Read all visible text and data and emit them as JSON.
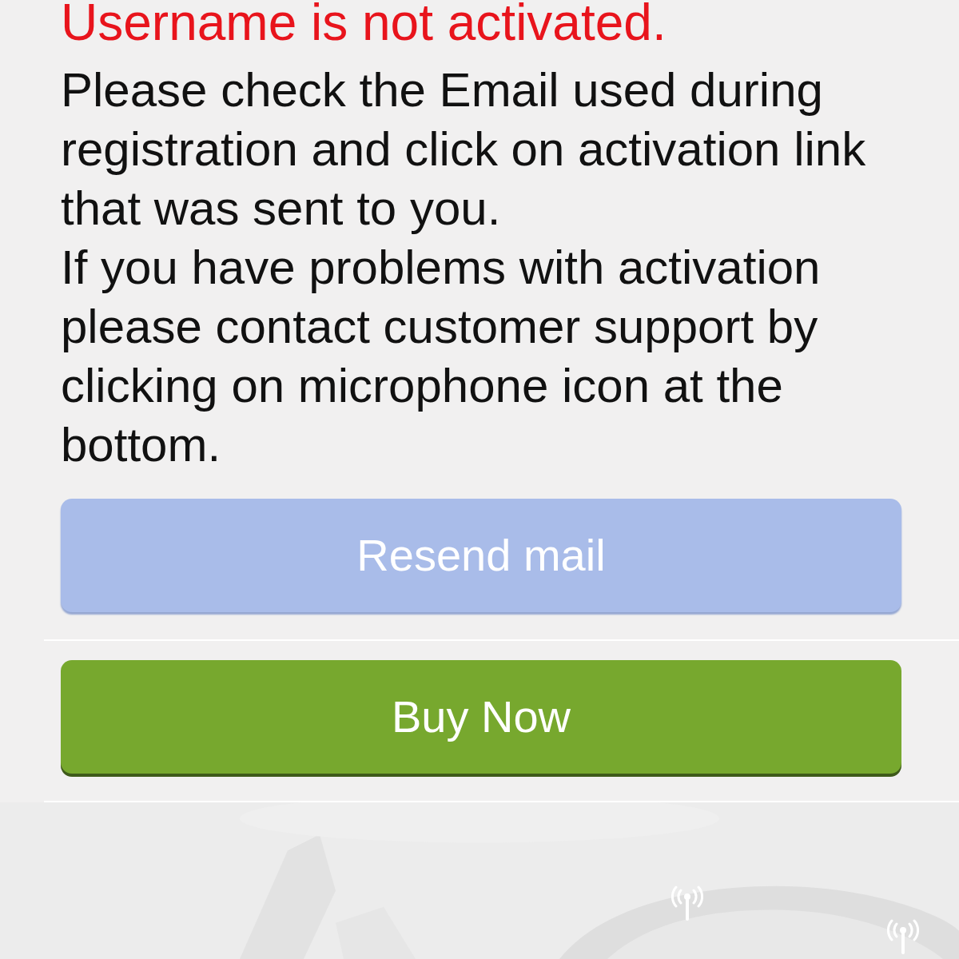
{
  "error_title": "Username is not activated.",
  "paragraphs": [
    "Please check the Email used during registration and click on activation link that was sent to you.",
    "If you have problems with activation please contact customer support by clicking on microphone icon at the bottom."
  ],
  "buttons": [
    {
      "label": "Resend mail",
      "kind": "secondary",
      "disabled": true
    },
    {
      "label": "Buy Now",
      "kind": "primary",
      "disabled": false
    }
  ]
}
